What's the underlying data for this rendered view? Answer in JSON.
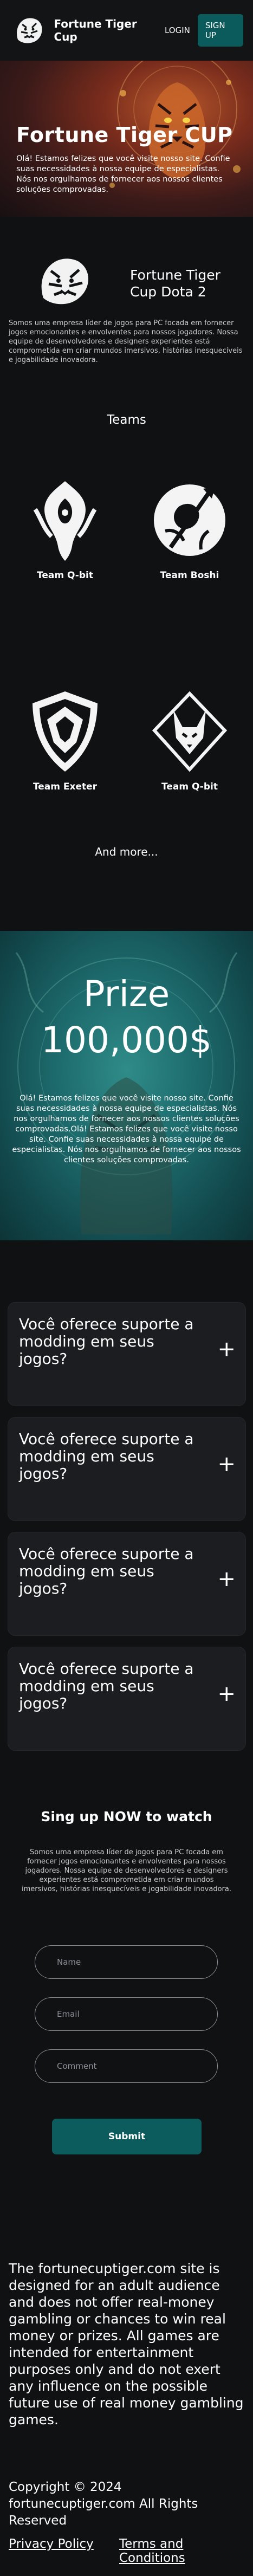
{
  "header": {
    "site_name": "Fortune Tiger Cup",
    "login_label": "LOGIN",
    "signup_label": "SIGN UP"
  },
  "hero": {
    "title": "Fortune Tiger CUP",
    "text": "Olá! Estamos felizes que você visite nosso site. Confie suas necessidades à nossa equipe de especialistas. Nós nos orgulhamos de fornecer aos nossos clientes soluções comprovadas."
  },
  "about": {
    "title": "Fortune Tiger Cup Dota 2",
    "text": "Somos uma empresa líder de jogos para PC focada em fornecer jogos emocionantes e envolventes para nossos jogadores. Nossa equipe de desenvolvedores e designers experientes está comprometida em criar mundos imersivos, histórias inesquecíveis e jogabilidade inovadora."
  },
  "teams": {
    "title": "Teams",
    "items": [
      {
        "name": "Team Q-bit"
      },
      {
        "name": "Team Boshi"
      },
      {
        "name": "Team Exeter"
      },
      {
        "name": "Team Q-bit"
      }
    ],
    "more_label": "And more..."
  },
  "prize": {
    "label": "Prize",
    "amount": "100,000$",
    "text": "Olá! Estamos felizes que você visite nosso site. Confie suas necessidades à nossa equipe de especialistas. Nós nos orgulhamos de fornecer aos nossos clientes soluções comprovadas.Olá! Estamos felizes que você visite nosso site. Confie suas necessidades à nossa equipe de especialistas. Nós nos orgulhamos de fornecer aos nossos clientes soluções comprovadas."
  },
  "faq": {
    "items": [
      {
        "question": "Você oferece suporte a modding em seus jogos?"
      },
      {
        "question": "Você oferece suporte a modding em seus jogos?"
      },
      {
        "question": "Você oferece suporte a modding em seus jogos?"
      },
      {
        "question": "Você oferece suporte a modding em seus jogos?"
      }
    ]
  },
  "signup": {
    "title": "Sing up NOW to watch",
    "text": "Somos uma empresa líder de jogos para PC focada em fornecer jogos emocionantes e envolventes para nossos jogadores. Nossa equipe de desenvolvedores e designers experientes está comprometida em criar mundos imersivos, histórias inesquecíveis e jogabilidade inovadora.",
    "name_placeholder": "Name",
    "email_placeholder": "Email",
    "comment_placeholder": "Comment",
    "submit_label": "Submit"
  },
  "footer": {
    "disclaimer": "The fortunecuptiger.com site is designed for an adult audience and does not offer real-money gambling or chances to win real money or prizes. All games are intended for entertainment purposes only and do not exert any influence on the possible future use of real money gambling games.",
    "copyright": "Copyright © 2024 fortunecuptiger.com All Rights Reserved",
    "privacy_label": "Privacy Policy",
    "terms_label": "Terms and Conditions"
  },
  "colors": {
    "accent": "#0d5c5d",
    "background": "#0f1113",
    "card": "#1b1d21"
  }
}
